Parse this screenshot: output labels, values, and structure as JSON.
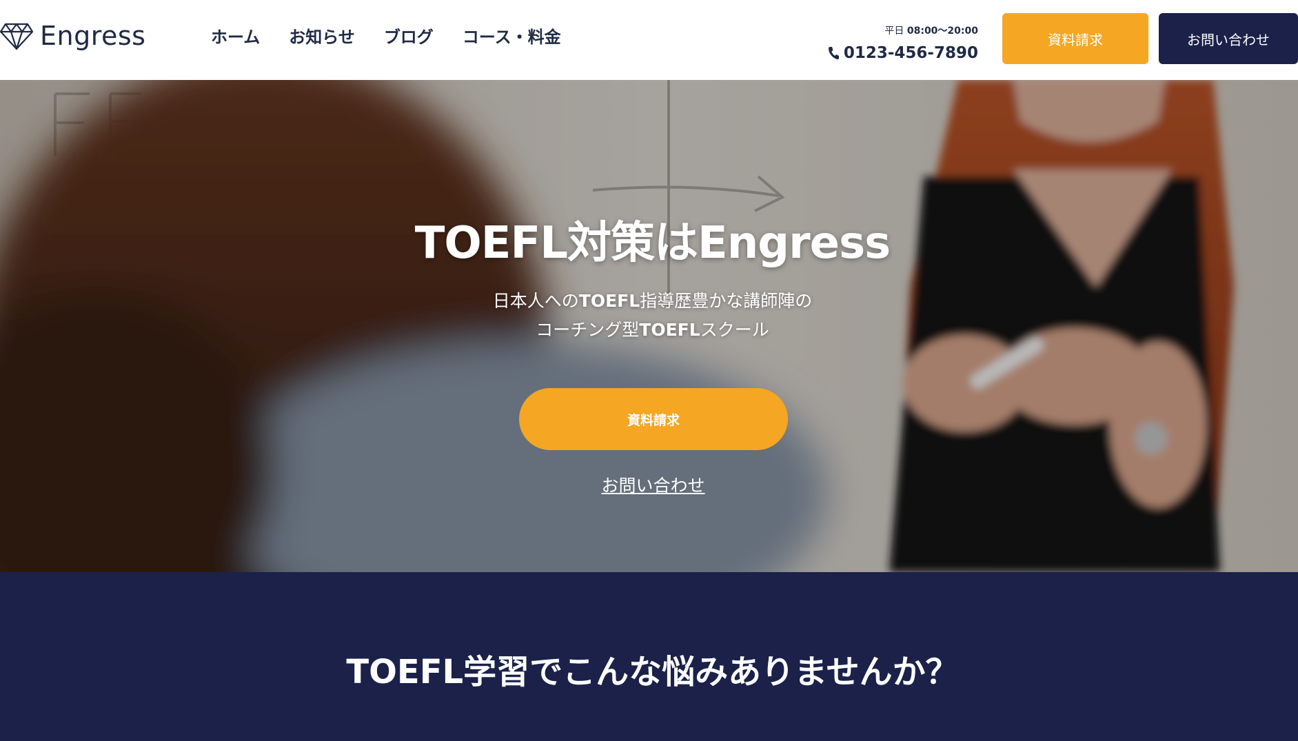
{
  "brand": {
    "name": "Engress",
    "icon": "diamond-icon"
  },
  "nav": {
    "items": [
      {
        "label": "ホーム"
      },
      {
        "label": "お知らせ"
      },
      {
        "label": "ブログ"
      },
      {
        "label": "コース・料金"
      }
    ]
  },
  "contact": {
    "hours_label": "平日",
    "hours_time": "08:00〜20:00",
    "phone_icon": "phone-icon",
    "phone": "0123-456-7890"
  },
  "header_buttons": {
    "request": "資料請求",
    "contact": "お問い合わせ"
  },
  "hero": {
    "title": "TOEFL対策はEngress",
    "subtitle_line1_pre": "日本人への",
    "subtitle_line1_bold": "TOEFL",
    "subtitle_line1_post": "指導歴豊かな講師陣の",
    "subtitle_line2_pre": "コーチング型",
    "subtitle_line2_bold": "TOEFL",
    "subtitle_line2_post": "スクール",
    "cta": "資料請求",
    "link": "お問い合わせ"
  },
  "problems": {
    "title": "TOEFL学習でこんな悩みありませんか？"
  },
  "colors": {
    "accent": "#f5a623",
    "navy": "#1b2149",
    "text_dark": "#1f2a44"
  }
}
